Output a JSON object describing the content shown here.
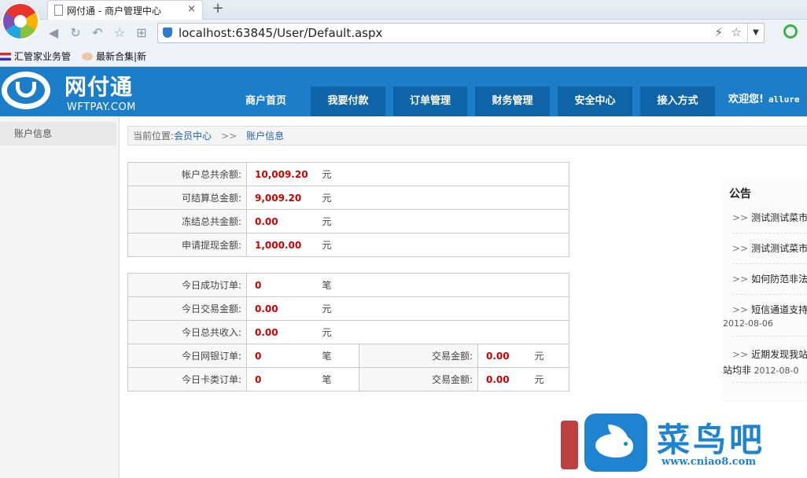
{
  "browser": {
    "tab_title": "网付通 - 商户管理中心",
    "tab_close": "×",
    "new_tab": "+",
    "url": "localhost:63845/User/Default.aspx",
    "bookmarks": [
      "汇管家业务管",
      "最新合集|新"
    ]
  },
  "site": {
    "logo_text": "网付通",
    "logo_sub": "WFTPAY.COM",
    "nav": [
      "商户首页",
      "我要付款",
      "订单管理",
      "财务管理",
      "安全中心",
      "接入方式"
    ],
    "welcome": "欢迎您!",
    "username": "allure",
    "brand_color": "#1c7dc9"
  },
  "sidebar": {
    "items": [
      "账户信息"
    ]
  },
  "breadcrumb": {
    "prefix": "当前位置:",
    "home": "会员中心",
    "sep": ">>",
    "current": "账户信息"
  },
  "account": [
    {
      "label": "帐户总共余额:",
      "value": "10,009.20",
      "unit": "元"
    },
    {
      "label": "可结算总金额:",
      "value": "9,009.20",
      "unit": "元"
    },
    {
      "label": "冻结总共金额:",
      "value": "0.00",
      "unit": "元"
    },
    {
      "label": "申请提现金额:",
      "value": "1,000.00",
      "unit": "元"
    }
  ],
  "today": [
    {
      "label": "今日成功订单:",
      "value": "0",
      "unit": "笔"
    },
    {
      "label": "今日交易金额:",
      "value": "0.00",
      "unit": "元"
    },
    {
      "label": "今日总共收入:",
      "value": "0.00",
      "unit": "元"
    },
    {
      "label": "今日网银订单:",
      "value": "0",
      "unit": "笔",
      "sub_label": "交易金额:",
      "sub_value": "0.00",
      "sub_unit": "元"
    },
    {
      "label": "今日卡类订单:",
      "value": "0",
      "unit": "笔",
      "sub_label": "交易金额:",
      "sub_value": "0.00",
      "sub_unit": "元"
    }
  ],
  "notice": {
    "title": "公告",
    "arrow": ">>",
    "items": [
      {
        "text": "测试测试菜市场"
      },
      {
        "text": "测试测试菜市场"
      },
      {
        "text": "如何防范非法钓"
      },
      {
        "text": "短信通道支持全",
        "date": "2012-08-06"
      },
      {
        "text": "近期发现我站被",
        "text2": "站均非",
        "date": "2012-08-0"
      }
    ]
  },
  "watermark": {
    "name": "菜鸟吧",
    "url": "www.cniao8.com"
  }
}
